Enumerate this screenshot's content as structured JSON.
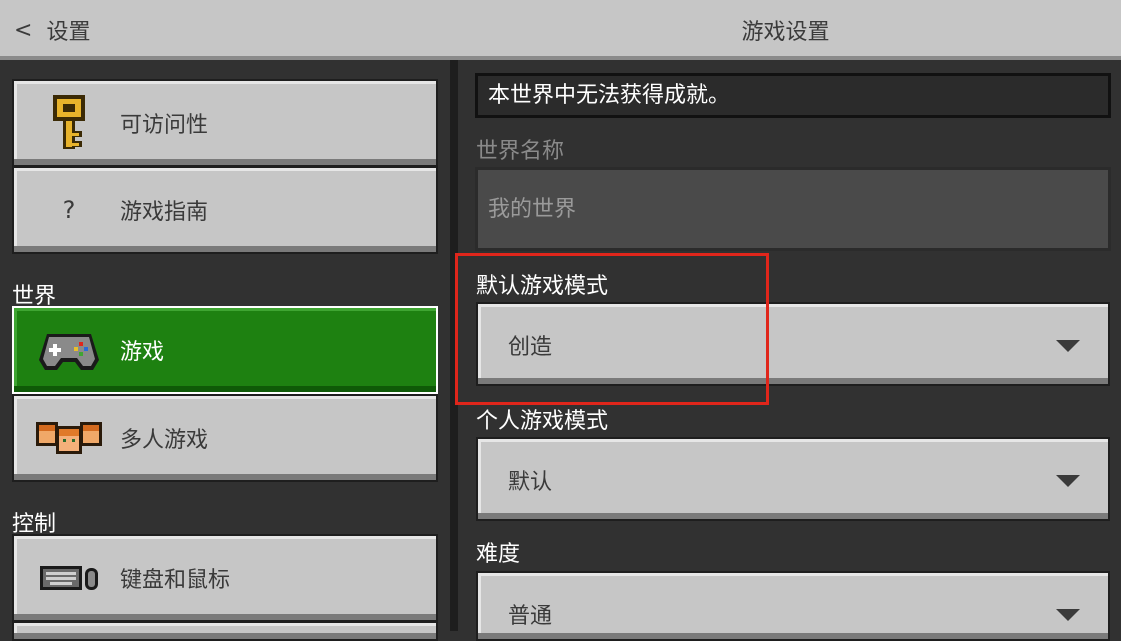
{
  "header": {
    "back_label": "设置",
    "title": "游戏设置"
  },
  "sidebar": {
    "items": [
      {
        "label": "可访问性",
        "icon": "key-icon"
      },
      {
        "label": "游戏指南",
        "icon": "question-icon",
        "glyph": "?"
      },
      {
        "label": "游戏",
        "icon": "controller-icon"
      },
      {
        "label": "多人游戏",
        "icon": "multiplayer-faces-icon"
      },
      {
        "label": "键盘和鼠标",
        "icon": "keyboard-mouse-icon"
      }
    ],
    "sections": {
      "world": "世界",
      "controls": "控制"
    }
  },
  "main": {
    "notice": "本世界中无法获得成就。",
    "world_name": {
      "label": "世界名称",
      "placeholder": "我的世界"
    },
    "default_game_mode": {
      "label": "默认游戏模式",
      "value": "创造"
    },
    "personal_game_mode": {
      "label": "个人游戏模式",
      "value": "默认"
    },
    "difficulty": {
      "label": "难度",
      "value": "普通"
    }
  },
  "colors": {
    "active_green": "#1e8111",
    "highlight_red": "#e0261b",
    "panel_gray": "#c6c6c6"
  }
}
